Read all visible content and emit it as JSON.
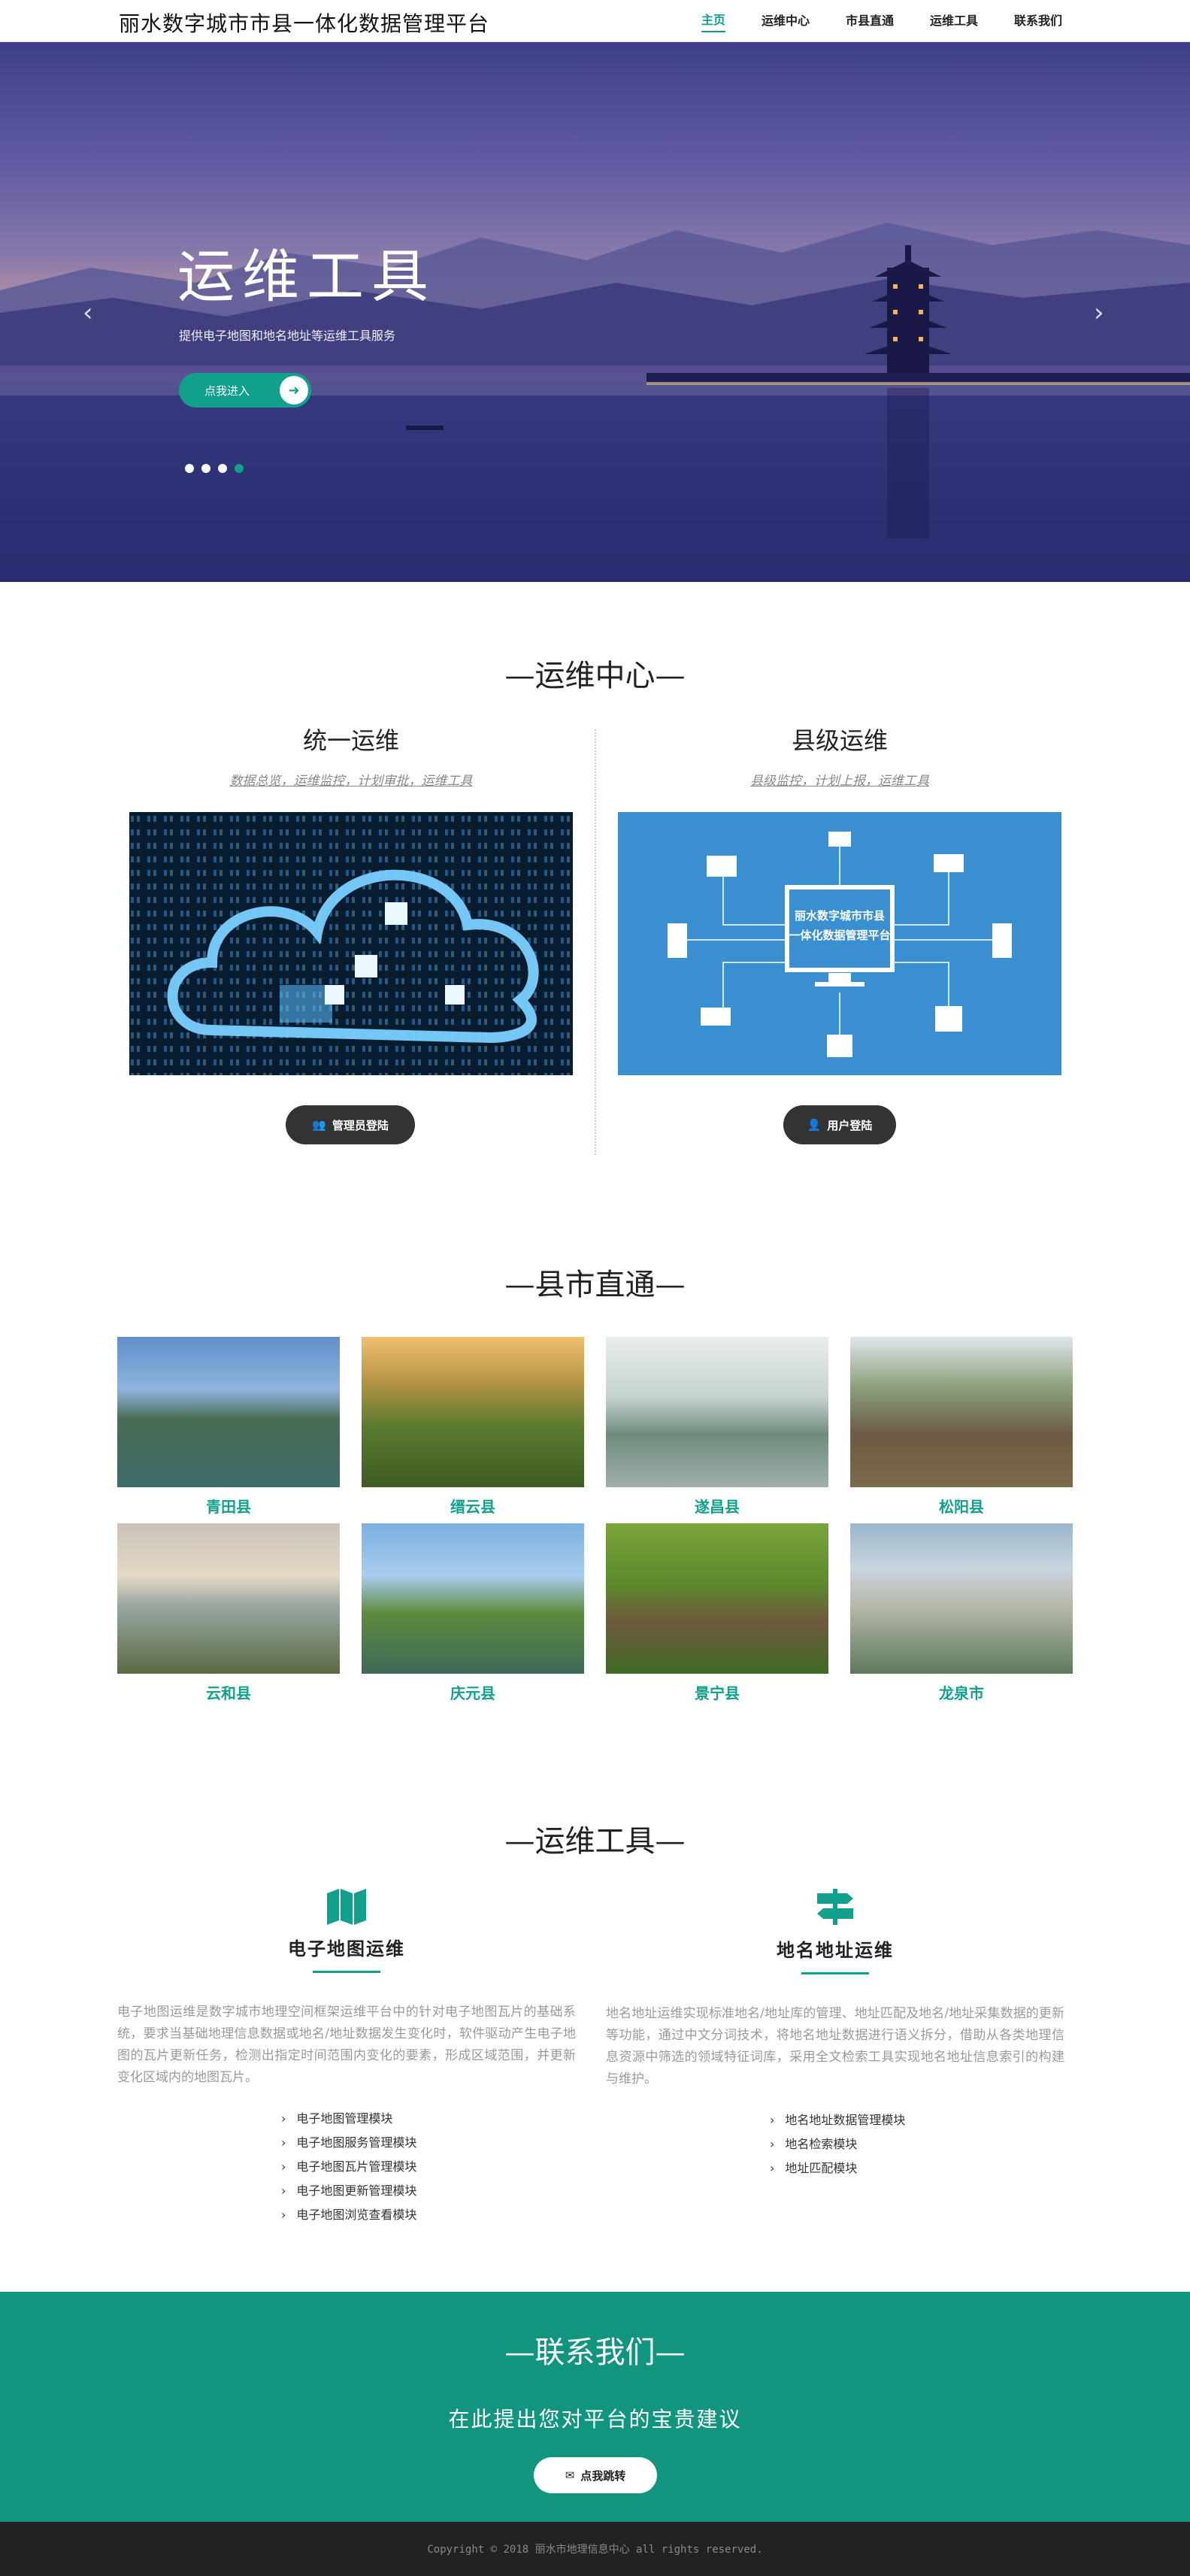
{
  "nav": {
    "brand": "丽水数字城市市县一体化数据管理平台",
    "items": [
      "主页",
      "运维中心",
      "市县直通",
      "运维工具",
      "联系我们"
    ],
    "active_index": 0
  },
  "hero": {
    "title": "运维工具",
    "subtitle": "提供电子地图和地名地址等运维工具服务",
    "button_label": "点我进入",
    "slide_count": 4,
    "active_slide": 4
  },
  "ops_center": {
    "title": "—运维中心—",
    "unified": {
      "heading": "统一运维",
      "desc": "数据总览，运维监控，计划审批，运维工具",
      "button_label": "管理员登陆"
    },
    "county": {
      "heading": "县级运维",
      "desc": "县级监控，计划上报，运维工具",
      "diagram_line1": "丽水数字城市市县",
      "diagram_line2": "一体化数据管理平台",
      "button_label": "用户登陆"
    }
  },
  "direct": {
    "title": "—县市直通—",
    "counties": [
      "青田县",
      "缙云县",
      "遂昌县",
      "松阳县",
      "云和县",
      "庆元县",
      "景宁县",
      "龙泉市"
    ]
  },
  "tools": {
    "title": "—运维工具—",
    "map": {
      "heading": "电子地图运维",
      "desc": "电子地图运维是数字城市地理空间框架运维平台中的针对电子地图瓦片的基础系统，要求当基础地理信息数据或地名/地址数据发生变化时，软件驱动产生电子地图的瓦片更新任务，检测出指定时间范围内变化的要素，形成区域范围，并更新变化区域内的地图瓦片。",
      "items": [
        "电子地图管理模块",
        "电子地图服务管理模块",
        "电子地图瓦片管理模块",
        "电子地图更新管理模块",
        "电子地图浏览查看模块"
      ]
    },
    "address": {
      "heading": "地名地址运维",
      "desc": "地名地址运维实现标准地名/地址库的管理、地址匹配及地名/地址采集数据的更新等功能，通过中文分词技术，将地名地址数据进行语义拆分，借助从各类地理信息资源中筛选的领域特征词库，采用全文检索工具实现地名地址信息索引的构建与维护。",
      "items": [
        "地名地址数据管理模块",
        "地名检索模块",
        "地址匹配模块"
      ]
    }
  },
  "contact": {
    "title": "—联系我们—",
    "subtitle": "在此提出您对平台的宝贵建议",
    "button_label": "点我跳转"
  },
  "footer": {
    "copyright": "Copyright © 2018 丽水市地理信息中心 all rights reserved."
  },
  "colors": {
    "accent": "#11a08b",
    "contact_bg": "#11957f",
    "footer_bg": "#222222",
    "dark_button": "#333333"
  }
}
